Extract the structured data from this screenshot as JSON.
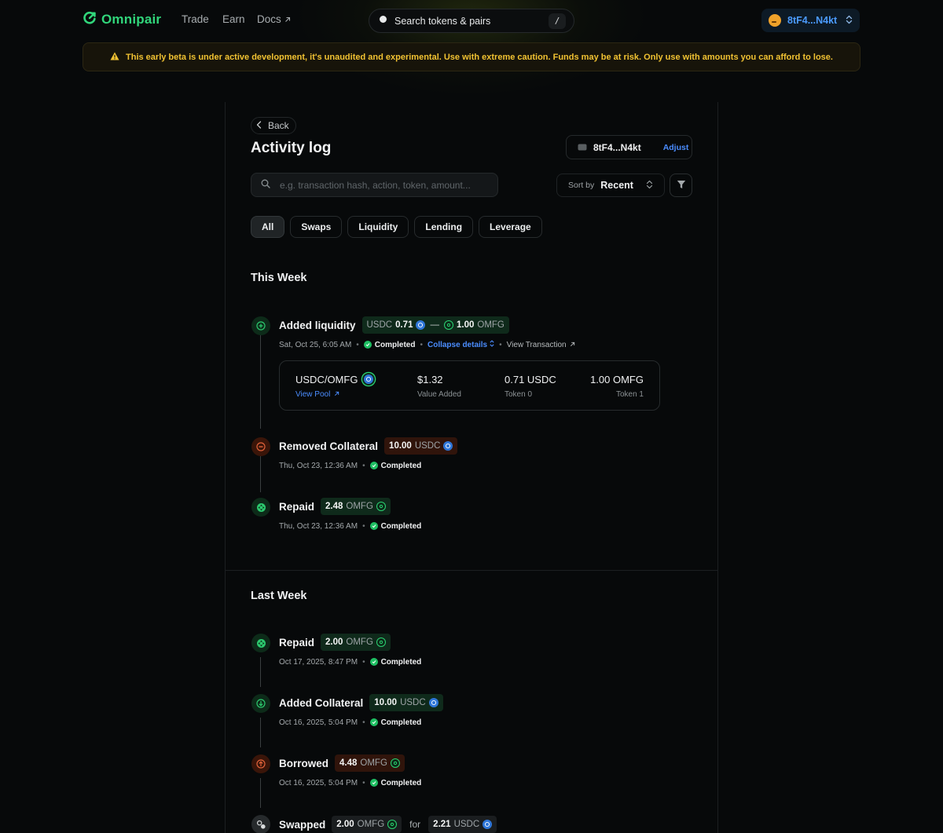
{
  "brand": {
    "name": "Omnipair",
    "accent": "#31d67b"
  },
  "nav": {
    "items": [
      {
        "label": "Trade"
      },
      {
        "label": "Earn"
      },
      {
        "label": "Docs",
        "icon": "external-link-icon"
      }
    ]
  },
  "top_search": {
    "label": "Search tokens & pairs",
    "shortcut": "/"
  },
  "wallet": {
    "address": "8tF4...N4kt"
  },
  "banner": {
    "text": "This early beta is under active development, it's unaudited and experimental. Use with extreme caution. Funds may be at risk. Only use with amounts you can afford to lose.",
    "color": "#f1c232"
  },
  "page": {
    "back_label": "Back",
    "title": "Activity log",
    "wallet_chip": {
      "address": "8tF4...N4kt",
      "action": "Adjust"
    },
    "search_placeholder": "e.g. transaction hash, action, token, amount...",
    "sort": {
      "label": "Sort by",
      "value": "Recent"
    },
    "tabs": [
      {
        "label": "All",
        "active": true
      },
      {
        "label": "Swaps"
      },
      {
        "label": "Liquidity"
      },
      {
        "label": "Lending"
      },
      {
        "label": "Leverage"
      }
    ]
  },
  "sections": [
    {
      "title": "This Week",
      "events": [
        {
          "action": "Added liquidity",
          "icon": "plus-icon",
          "tone": "green",
          "pill": {
            "sym_a": "USDC",
            "amt_a": "0.71",
            "amt_b": "1.00",
            "sym_b": "OMFG"
          },
          "time": "Sat, Oct 25, 6:05 AM",
          "status": "Completed",
          "collapse_label": "Collapse details",
          "view_tx_label": "View Transaction",
          "details": {
            "pair": "USDC/OMFG",
            "view_pool": "View Pool",
            "value": "$1.32",
            "value_label": "Value Added",
            "token0": "0.71 USDC",
            "token0_label": "Token 0",
            "token1": "1.00 OMFG",
            "token1_label": "Token 1"
          }
        },
        {
          "action": "Removed Collateral",
          "icon": "minus-icon",
          "tone": "red",
          "pill": {
            "amt": "10.00",
            "sym": "USDC"
          },
          "time": "Thu, Oct 23, 12:36 AM",
          "status": "Completed"
        },
        {
          "action": "Repaid",
          "icon": "repay-icon",
          "tone": "green",
          "pill": {
            "amt": "2.48",
            "sym": "OMFG"
          },
          "time": "Thu, Oct 23, 12:36 AM",
          "status": "Completed"
        }
      ]
    },
    {
      "title": "Last Week",
      "events": [
        {
          "action": "Repaid",
          "icon": "repay-icon",
          "tone": "green",
          "pill": {
            "amt": "2.00",
            "sym": "OMFG"
          },
          "time": "Oct 17, 2025, 8:47 PM",
          "status": "Completed"
        },
        {
          "action": "Added Collateral",
          "icon": "arrow-down-icon",
          "tone": "green",
          "pill": {
            "amt": "10.00",
            "sym": "USDC"
          },
          "time": "Oct 16, 2025, 5:04 PM",
          "status": "Completed"
        },
        {
          "action": "Borrowed",
          "icon": "arrow-up-icon",
          "tone": "red",
          "pill": {
            "amt": "4.48",
            "sym": "OMFG"
          },
          "time": "Oct 16, 2025, 5:04 PM",
          "status": "Completed"
        },
        {
          "action": "Swapped",
          "icon": "swap-icon",
          "tone": "gray",
          "pill": {
            "amt": "2.00",
            "sym": "OMFG"
          },
          "for_label": "for",
          "pill2": {
            "amt": "2.21",
            "sym": "USDC"
          }
        }
      ]
    }
  ]
}
